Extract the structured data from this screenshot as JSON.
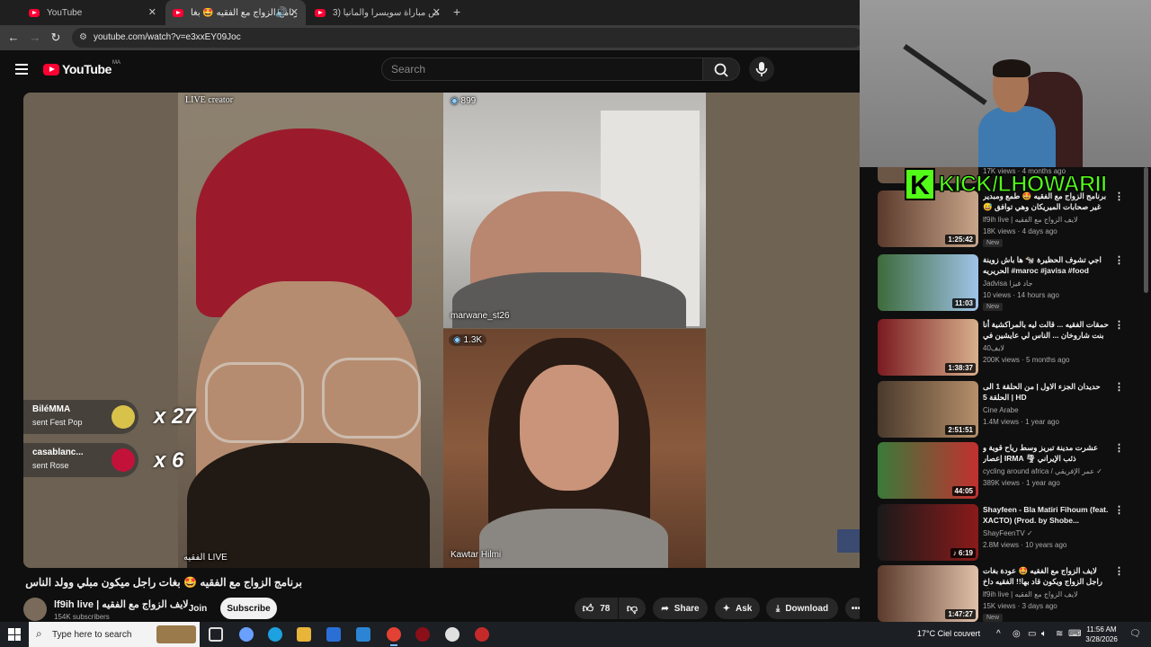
{
  "browser": {
    "tabs": [
      {
        "title": "YouTube"
      },
      {
        "title": "برنامج الزواج مع الفقيه 🤩 بغا..."
      },
      {
        "title": "ملخص مباراة سويسرا وألمانيا (3..."
      }
    ],
    "url": "youtube.com/watch?v=e3xxEY09Joc"
  },
  "header": {
    "logo_text": "YouTube",
    "country_code": "MA",
    "search_placeholder": "Search"
  },
  "player": {
    "live_creator": "LIVE creator",
    "viewers_top": "899",
    "viewers_bottom": "1.3K",
    "guest_top": "marwane_st26",
    "guest_bottom": "Kawtar Hilmi",
    "host_tag": "الفقيه LIVE",
    "gifts": [
      {
        "name": "BiléMMA",
        "sent": "sent Fest Pop",
        "multiplier": "x 27"
      },
      {
        "name": "casablanc...",
        "sent": "sent Rose",
        "multiplier": "x 6"
      }
    ]
  },
  "video": {
    "title": "برنامج الزواج مع الفقيه 🤩 بغات راجل ميكون مبلي وولد الناس للزواج",
    "channel": "lf9ih live | لايف الزواج مع الفقيه",
    "subscribers": "154K subscribers",
    "join_label": "Join",
    "subscribe_label": "Subscribe",
    "likes": "78",
    "share_label": "Share",
    "ask_label": "Ask",
    "download_label": "Download"
  },
  "streamer_overlay": {
    "banner": "KICK/LHOWARII",
    "banner_letter": "K"
  },
  "sidebar": {
    "partial_top_meta": "17K views · 4 months ago",
    "items": [
      {
        "title": "برنامج الزواج مع الفقيه 🤩 طمع ومبدير غير صحابات الميريكان وهي توافق 😅 الموت ديال...",
        "channel": "lf9ih live | لايف الزواج مع الفقيه",
        "meta": "18K views · 4 days ago",
        "badge": "New",
        "duration": "1:25:42",
        "colors": [
          "#5b3a2c",
          "#c8a58a"
        ]
      },
      {
        "title": "اجي تشوف الحظيرة 🐄 ها باش زوينة الحريريه #maroc #javisa #food",
        "channel": "Jadvisa جاد فيزا",
        "meta": "10 views · 14 hours ago",
        "badge": "New",
        "duration": "11:03",
        "colors": [
          "#3d6b3a",
          "#9fc3e8"
        ]
      },
      {
        "title": "حمقات الفقيه ... قالت ليه بالمراكشية أنا بنت شاروخان ... الناس لي عايشين في اوروبا ...",
        "channel": "لايف40",
        "meta": "200K views · 5 months ago",
        "badge": "",
        "duration": "1:38:37",
        "colors": [
          "#7a1a20",
          "#d8b08c"
        ]
      },
      {
        "title": "حديدان الجزء الاول | من الحلقة 1 الى الحلقة 5 | HD",
        "channel": "Cine Arabe",
        "meta": "1.4M views · 1 year ago",
        "badge": "",
        "duration": "2:51:51",
        "colors": [
          "#4a3a2c",
          "#b58f6a"
        ]
      },
      {
        "title": "عشرت مدينة تبريز وسط رياح قوية و إعصار IRMA 🌪 ذئب الإيراني",
        "channel": "cycling around africa / عمر الإفريقي ✓",
        "meta": "389K views · 1 year ago",
        "badge": "",
        "duration": "44:05",
        "colors": [
          "#3a7a3a",
          "#c23030"
        ]
      },
      {
        "title": "Shayfeen - Bla Matiri Fihoum (feat. XACTO) (Prod. by Shobe...",
        "channel": "ShayFeenTV ✓",
        "meta": "2.8M views · 10 years ago",
        "badge": "",
        "duration": "♪ 6:19",
        "colors": [
          "#1a1a1a",
          "#8a1a1a"
        ]
      },
      {
        "title": "لايف الزواج مع الفقيه 🤩 عودة بغات راجل الزواج ويكون قاد بها!! الفقيه داخ 😂",
        "channel": "lf9ih live | لايف الزواج مع الفقيه",
        "meta": "15K views · 3 days ago",
        "badge": "New",
        "duration": "1:47:27",
        "colors": [
          "#5b3a2c",
          "#e0c0a8"
        ]
      }
    ]
  },
  "taskbar": {
    "search_placeholder": "Type here to search",
    "weather": "17°C  Ciel couvert",
    "time": "11:56 AM",
    "date": "3/28/2026"
  }
}
